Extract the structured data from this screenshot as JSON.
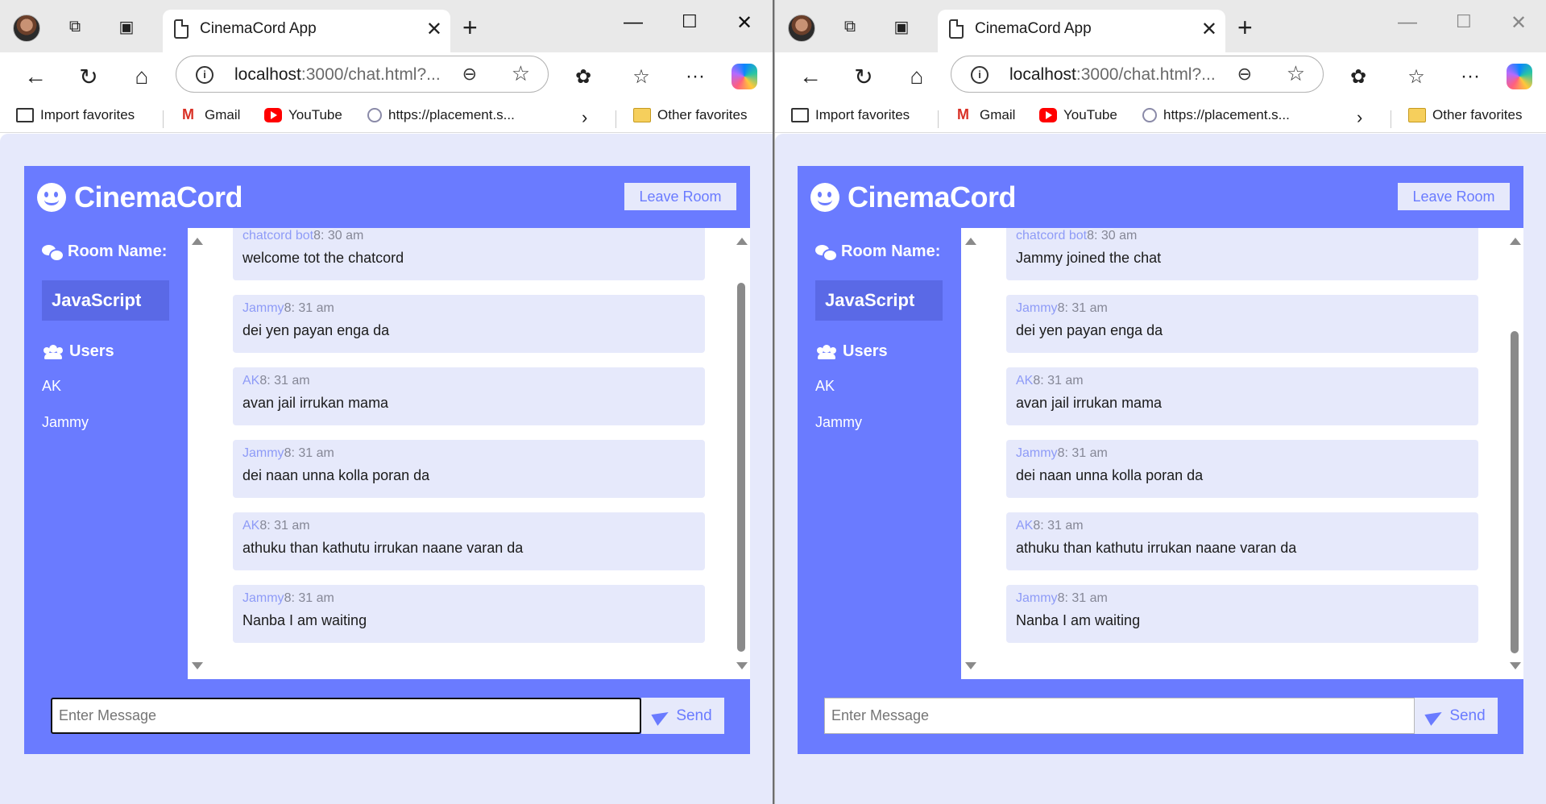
{
  "windows": [
    {
      "id": "left",
      "tab_title": "CinemaCord App",
      "url_host": "localhost",
      "url_rest": ":3000/chat.html?...",
      "favorites": [
        "Import favorites",
        "Gmail",
        "YouTube",
        "https://placement.s...",
        "Other favorites"
      ],
      "app_name": "CinemaCord",
      "leave_label": "Leave Room",
      "room_label": "Room Name:",
      "room_name": "JavaScript",
      "users_label": "Users",
      "users": [
        "AK",
        "Jammy"
      ],
      "messages": [
        {
          "name": "chatcord bot",
          "time": "8: 30 am",
          "text": "welcome tot the chatcord"
        },
        {
          "name": "Jammy",
          "time": "8: 31 am",
          "text": "dei yen payan enga da"
        },
        {
          "name": "AK",
          "time": "8: 31 am",
          "text": "avan jail irrukan mama"
        },
        {
          "name": "Jammy",
          "time": "8: 31 am",
          "text": "dei naan unna kolla poran da"
        },
        {
          "name": "AK",
          "time": "8: 31 am",
          "text": "athuku than kathutu irrukan naane varan da"
        },
        {
          "name": "Jammy",
          "time": "8: 31 am",
          "text": "Nanba I am waiting"
        }
      ],
      "input_placeholder": "Enter Message",
      "send_label": "Send"
    },
    {
      "id": "right",
      "tab_title": "CinemaCord App",
      "url_host": "localhost",
      "url_rest": ":3000/chat.html?...",
      "favorites": [
        "Import favorites",
        "Gmail",
        "YouTube",
        "https://placement.s...",
        "Other favorites"
      ],
      "app_name": "CinemaCord",
      "leave_label": "Leave Room",
      "room_label": "Room Name:",
      "room_name": "JavaScript",
      "users_label": "Users",
      "users": [
        "AK",
        "Jammy"
      ],
      "messages": [
        {
          "name": "chatcord bot",
          "time": "8: 30 am",
          "text": "Jammy joined the chat"
        },
        {
          "name": "Jammy",
          "time": "8: 31 am",
          "text": "dei yen payan enga da"
        },
        {
          "name": "AK",
          "time": "8: 31 am",
          "text": "avan jail irrukan mama"
        },
        {
          "name": "Jammy",
          "time": "8: 31 am",
          "text": "dei naan unna kolla poran da"
        },
        {
          "name": "AK",
          "time": "8: 31 am",
          "text": "athuku than kathutu irrukan naane varan da"
        },
        {
          "name": "Jammy",
          "time": "8: 31 am",
          "text": "Nanba I am waiting"
        }
      ],
      "input_placeholder": "Enter Message",
      "send_label": "Send"
    }
  ],
  "colors": {
    "accent": "#6a7bff",
    "accent_dark": "#5a69e6",
    "light": "#e6e9fb",
    "meta_name": "#8e9bf7"
  },
  "icons": {
    "tab": [
      "avatar",
      "workspaces-icon",
      "tab-actions-icon",
      "page-icon",
      "close-icon",
      "new-tab-icon"
    ],
    "nav": [
      "back-icon",
      "refresh-icon",
      "home-icon",
      "info-icon",
      "zoom-icon",
      "star-icon",
      "extensions-icon",
      "favorites-icon",
      "more-icon",
      "copilot-icon"
    ],
    "app": [
      "smiley-icon",
      "comments-icon",
      "users-icon",
      "paper-plane-icon"
    ]
  }
}
